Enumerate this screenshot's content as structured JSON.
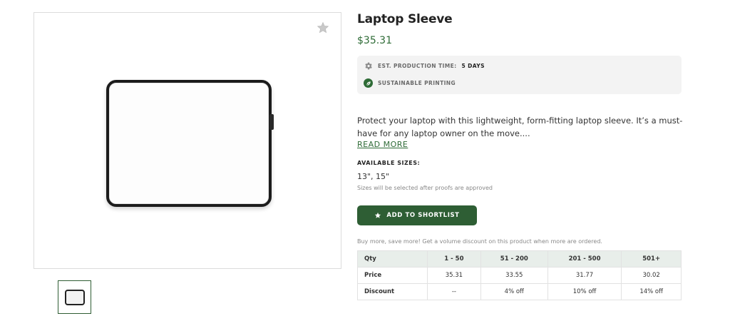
{
  "product": {
    "title": "Laptop Sleeve",
    "price": "$35.31",
    "image_alt": "Laptop sleeve",
    "info": {
      "production_label": "EST. PRODUCTION TIME:",
      "production_value": "5 DAYS",
      "sustainable_label": "SUSTAINABLE PRINTING"
    },
    "description": "Protect your laptop with this lightweight, form-fitting laptop sleeve. It’s a must-have for any laptop owner on the move....",
    "read_more": "READ MORE",
    "sizes_label": "AVAILABLE SIZES:",
    "sizes_value": "13\", 15\"",
    "sizes_note": "Sizes will be selected after proofs are approved",
    "shortlist_button": "ADD TO SHORTLIST",
    "volume_note": "Buy more, save more! Get a volume discount on this product when more are ordered."
  },
  "pricing_table": {
    "headers": [
      "Qty",
      "1 - 50",
      "51 - 200",
      "201 - 500",
      "501+"
    ],
    "rows": [
      [
        "Price",
        "35.31",
        "33.55",
        "31.77",
        "30.02"
      ],
      [
        "Discount",
        "--",
        "4% off",
        "10% off",
        "14% off"
      ]
    ]
  },
  "icons": {
    "favorite": "star-icon",
    "production": "gear-icon",
    "sustainable": "leaf-icon",
    "button": "star-icon"
  },
  "colors": {
    "accent": "#2e6b36",
    "button": "#2e5e34",
    "table_header": "#e8eeea",
    "info_box": "#f3f3f3"
  }
}
